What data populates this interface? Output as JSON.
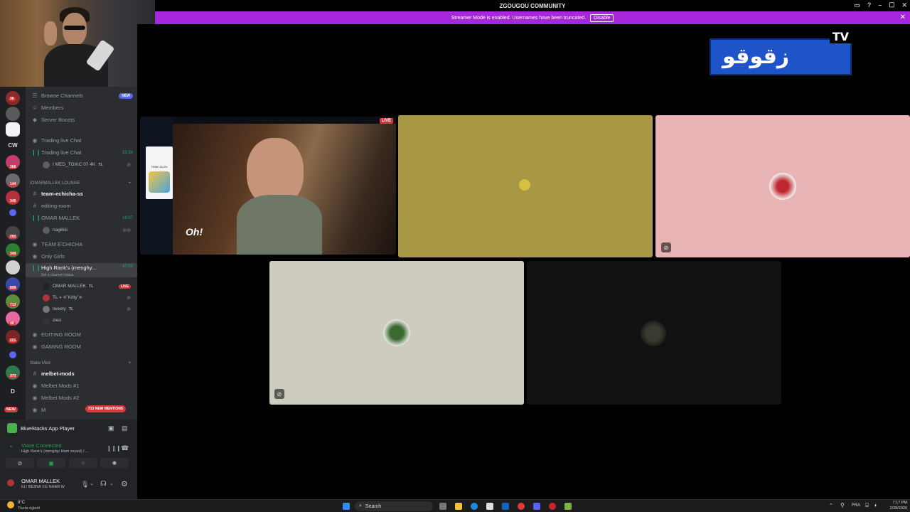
{
  "window": {
    "title": "ZGOUGOU COMMUNITY",
    "banner_text": "Streamer Mode is enabled. Usernames have been truncated.",
    "banner_button": "Disable"
  },
  "rail": {
    "badges": [
      "36",
      "368",
      "144",
      "345",
      "292",
      "349",
      "899",
      "713",
      "49",
      "221",
      "373"
    ],
    "labels": {
      "cw": "CW",
      "d": "D",
      "new": "NEW"
    }
  },
  "sidebar": {
    "top_items": [
      {
        "label": "Browse Channels",
        "badge": "NEW",
        "icon": "browse-icon"
      },
      {
        "label": "Members",
        "icon": "members-icon"
      },
      {
        "label": "Server Boosts",
        "icon": "boost-icon"
      }
    ],
    "channels1": [
      {
        "label": "Trading live Chat",
        "icon": "speaker-icon"
      },
      {
        "label": "Trading live Chat",
        "icon": "voice-live-icon",
        "time": "23:34"
      }
    ],
    "voice_user_a": "I MED_TOXIC 07 4K",
    "voice_user_a_tag": "TL",
    "category1": "IOMARMALLEK LOUNGE",
    "channels2": [
      {
        "label": "team-echicha-ss"
      },
      {
        "label": "editing-room"
      },
      {
        "label": "OMAR MALLEK",
        "time": "16:07"
      }
    ],
    "voice_user_b": "nagiliiiii",
    "channels3": [
      {
        "label": "TEAM E'CHICHA"
      },
      {
        "label": "Only Girls"
      },
      {
        "label": "High Rank's (menghy...",
        "time": "47:03",
        "status": "Set a channel status"
      }
    ],
    "voice_users": [
      {
        "name": "OMAR MALLEK",
        "tag": "TL",
        "live": "LIVE"
      },
      {
        "name": "TL ⭑ ☆˚Kitty˚☆",
        "tag": ""
      },
      {
        "name": "tweety",
        "tag": "TL"
      },
      {
        "name": "zled",
        "tag": ""
      }
    ],
    "channels4": [
      {
        "label": "EDITING ROOM"
      },
      {
        "label": "GAMING ROOM"
      }
    ],
    "category2": "Stake Mod",
    "channels5": [
      {
        "label": "melbet-mods"
      },
      {
        "label": "Melbet Mods #1"
      },
      {
        "label": "Melbet Mods #2"
      },
      {
        "label": "M"
      }
    ],
    "mentions": "713 NEW MENTIONS"
  },
  "panel": {
    "activity": "BlueStacks App Player",
    "voice_status": "Voice Connected",
    "voice_channel": "High Rank's (menghyr klam zeyed) / ...",
    "username": "OMAR MALLEK",
    "user_status": "EL! BE3NA Y.E NHAR W"
  },
  "stage": {
    "live_label": "LIVE",
    "stream_overlay": "Oh!",
    "card_text": "TIMM 15,2%",
    "logo_text": "زقوقو",
    "logo_tv": "TV"
  },
  "taskbar": {
    "weather_temp": "9°C",
    "weather_desc": "Tiszta égbolt",
    "search": "Search",
    "lang": "FRA",
    "time": "7:17 PM",
    "date": "2/28/2026"
  },
  "colors": {
    "banner": "#a727dd",
    "tile_olive": "#a89745",
    "tile_pink": "#e8b4b5",
    "tile_grey": "#cdccbe",
    "tile_dark": "#111111"
  }
}
